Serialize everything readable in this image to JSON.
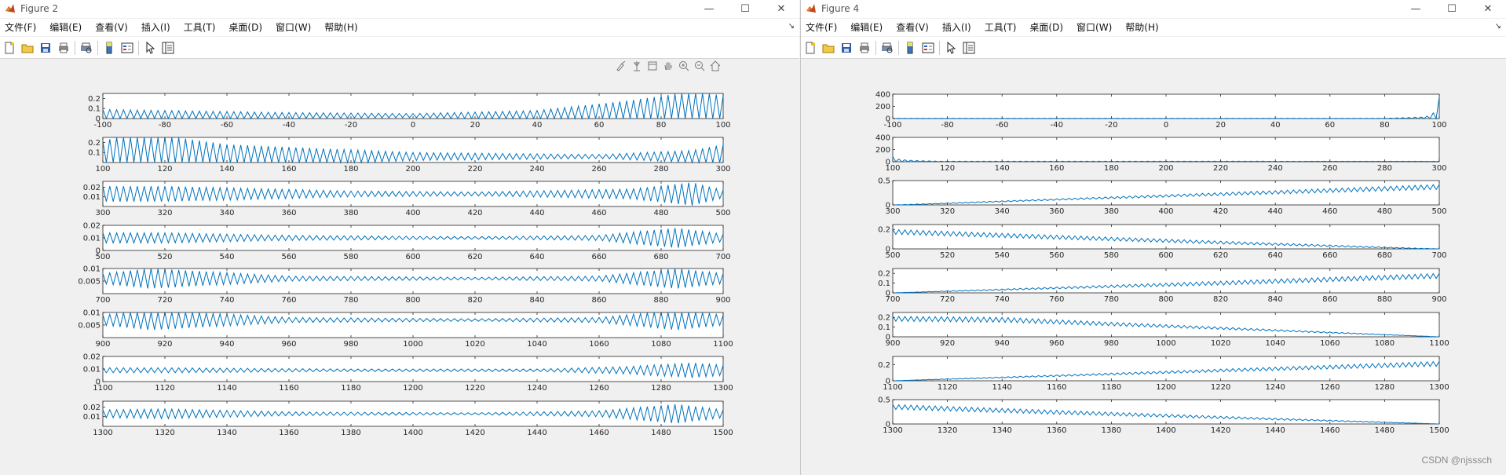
{
  "windows": [
    {
      "title": "Figure 2",
      "menu": [
        "文件(F)",
        "编辑(E)",
        "查看(V)",
        "插入(I)",
        "工具(T)",
        "桌面(D)",
        "窗口(W)",
        "帮助(H)"
      ],
      "toolbar_icons": [
        "new-figure-icon",
        "open-file-icon",
        "save-icon",
        "print-icon",
        "separator",
        "print-preview-icon",
        "separator",
        "colorbar-icon",
        "legend-icon",
        "separator",
        "pointer-icon",
        "property-inspector-icon"
      ],
      "axes_toolbar": [
        "brush-icon",
        "data-cursor-icon",
        "rotate-icon",
        "pan-icon",
        "zoom-in-icon",
        "zoom-out-icon",
        "home-icon"
      ]
    },
    {
      "title": "Figure 4",
      "menu": [
        "文件(F)",
        "编辑(E)",
        "查看(V)",
        "插入(I)",
        "工具(T)",
        "桌面(D)",
        "窗口(W)",
        "帮助(H)"
      ],
      "toolbar_icons": [
        "new-figure-icon",
        "open-file-icon",
        "save-icon",
        "print-icon",
        "separator",
        "print-preview-icon",
        "separator",
        "colorbar-icon",
        "legend-icon",
        "separator",
        "pointer-icon",
        "property-inspector-icon"
      ]
    }
  ],
  "watermark": "CSDN @njsssch",
  "colors": {
    "line": "#0072bd",
    "axes_bg": "#ffffff",
    "figure_bg": "#f0f0f0"
  },
  "chart_data": [
    {
      "figure": "Figure 2",
      "type": "line",
      "subplots": [
        {
          "xlim": [
            -100,
            100
          ],
          "xticks": [
            -100,
            -80,
            -60,
            -40,
            -20,
            0,
            20,
            40,
            60,
            80,
            100
          ],
          "yticks": [
            0,
            0.1,
            0.2
          ],
          "ytick_labels": [
            "0",
            "0.1",
            "0.2"
          ],
          "ylim": [
            0,
            0.25
          ],
          "envelope": [
            [
              -100,
              0.06
            ],
            [
              -80,
              0.05
            ],
            [
              -40,
              0.03
            ],
            [
              0,
              0.02
            ],
            [
              40,
              0.05
            ],
            [
              70,
              0.15
            ],
            [
              90,
              0.24
            ],
            [
              100,
              0.2
            ]
          ],
          "baseline": 0.03
        },
        {
          "xlim": [
            100,
            300
          ],
          "xticks": [
            100,
            120,
            140,
            160,
            180,
            200,
            220,
            240,
            260,
            280,
            300
          ],
          "yticks": [
            0.1,
            0.2
          ],
          "ytick_labels": [
            "0.1",
            "0.2"
          ],
          "ylim": [
            0,
            0.25
          ],
          "envelope": [
            [
              100,
              0.15
            ],
            [
              110,
              0.25
            ],
            [
              140,
              0.12
            ],
            [
              200,
              0.04
            ],
            [
              260,
              0.02
            ],
            [
              290,
              0.06
            ],
            [
              300,
              0.12
            ]
          ],
          "baseline": 0.06
        },
        {
          "xlim": [
            300,
            500
          ],
          "xticks": [
            300,
            320,
            340,
            360,
            380,
            400,
            420,
            440,
            460,
            480,
            500
          ],
          "yticks": [
            0.01,
            0.02
          ],
          "ytick_labels": [
            "0.01",
            "0.02"
          ],
          "ylim": [
            0,
            0.026
          ],
          "envelope": [
            [
              300,
              0.008
            ],
            [
              320,
              0.008
            ],
            [
              380,
              0.003
            ],
            [
              420,
              0.002
            ],
            [
              470,
              0.005
            ],
            [
              490,
              0.012
            ],
            [
              500,
              0.004
            ]
          ],
          "baseline": 0.013
        },
        {
          "xlim": [
            500,
            700
          ],
          "xticks": [
            500,
            520,
            540,
            560,
            580,
            600,
            620,
            640,
            660,
            680,
            700
          ],
          "yticks": [
            0,
            0.01,
            0.02
          ],
          "ytick_labels": [
            "0",
            "0.01",
            "0.02"
          ],
          "ylim": [
            0,
            0.02
          ],
          "envelope": [
            [
              500,
              0.004
            ],
            [
              520,
              0.004
            ],
            [
              560,
              0.002
            ],
            [
              620,
              0.001
            ],
            [
              660,
              0.002
            ],
            [
              685,
              0.008
            ],
            [
              700,
              0.003
            ]
          ],
          "baseline": 0.01
        },
        {
          "xlim": [
            700,
            900
          ],
          "xticks": [
            700,
            720,
            740,
            760,
            780,
            800,
            820,
            840,
            860,
            880,
            900
          ],
          "yticks": [
            0.005,
            0.01
          ],
          "ytick_labels": [
            "0.005",
            "0.01"
          ],
          "ylim": [
            0,
            0.01
          ],
          "envelope": [
            [
              700,
              0.002
            ],
            [
              715,
              0.004
            ],
            [
              760,
              0.001
            ],
            [
              820,
              0.0005
            ],
            [
              860,
              0.001
            ],
            [
              885,
              0.004
            ],
            [
              900,
              0.002
            ]
          ],
          "baseline": 0.006
        },
        {
          "xlim": [
            900,
            1100
          ],
          "xticks": [
            900,
            920,
            940,
            960,
            980,
            1000,
            1020,
            1040,
            1060,
            1080,
            1100
          ],
          "yticks": [
            0.005,
            0.01
          ],
          "ytick_labels": [
            "0.005",
            "0.01"
          ],
          "ylim": [
            0,
            0.01
          ],
          "envelope": [
            [
              900,
              0.002
            ],
            [
              915,
              0.004
            ],
            [
              960,
              0.001
            ],
            [
              1020,
              0.0005
            ],
            [
              1060,
              0.001
            ],
            [
              1085,
              0.004
            ],
            [
              1100,
              0.002
            ]
          ],
          "baseline": 0.007
        },
        {
          "xlim": [
            1100,
            1300
          ],
          "xticks": [
            1100,
            1120,
            1140,
            1160,
            1180,
            1200,
            1220,
            1240,
            1260,
            1280,
            1300
          ],
          "yticks": [
            0,
            0.01,
            0.02
          ],
          "ytick_labels": [
            "0",
            "0.01",
            "0.02"
          ],
          "ylim": [
            0,
            0.02
          ],
          "envelope": [
            [
              1100,
              0.002
            ],
            [
              1120,
              0.002
            ],
            [
              1180,
              0.001
            ],
            [
              1240,
              0.001
            ],
            [
              1270,
              0.003
            ],
            [
              1290,
              0.006
            ],
            [
              1300,
              0.004
            ]
          ],
          "baseline": 0.009
        },
        {
          "xlim": [
            1300,
            1500
          ],
          "xticks": [
            1300,
            1320,
            1340,
            1360,
            1380,
            1400,
            1420,
            1440,
            1460,
            1480,
            1500
          ],
          "yticks": [
            0.01,
            0.02
          ],
          "ytick_labels": [
            "0.01",
            "0.02"
          ],
          "ylim": [
            0,
            0.026
          ],
          "envelope": [
            [
              1300,
              0.004
            ],
            [
              1320,
              0.005
            ],
            [
              1360,
              0.002
            ],
            [
              1420,
              0.001
            ],
            [
              1460,
              0.003
            ],
            [
              1485,
              0.01
            ],
            [
              1500,
              0.004
            ]
          ],
          "baseline": 0.013
        }
      ]
    },
    {
      "figure": "Figure 4",
      "type": "line",
      "subplots": [
        {
          "xlim": [
            -100,
            100
          ],
          "xticks": [
            -100,
            -80,
            -60,
            -40,
            -20,
            0,
            20,
            40,
            60,
            80,
            100
          ],
          "yticks": [
            0,
            200,
            400
          ],
          "ytick_labels": [
            "0",
            "200",
            "400"
          ],
          "ylim": [
            0,
            400
          ],
          "envelope": [
            [
              -100,
              3
            ],
            [
              80,
              3
            ],
            [
              95,
              25
            ],
            [
              99,
              120
            ],
            [
              100,
              350
            ]
          ],
          "baseline": 2
        },
        {
          "xlim": [
            100,
            300
          ],
          "xticks": [
            100,
            120,
            140,
            160,
            180,
            200,
            220,
            240,
            260,
            280,
            300
          ],
          "yticks": [
            0,
            200,
            400
          ],
          "ytick_labels": [
            "0",
            "200",
            "400"
          ],
          "ylim": [
            0,
            400
          ],
          "envelope": [
            [
              100,
              80
            ],
            [
              102,
              40
            ],
            [
              106,
              20
            ],
            [
              115,
              6
            ],
            [
              300,
              2
            ]
          ],
          "baseline": 5
        },
        {
          "xlim": [
            300,
            500
          ],
          "xticks": [
            300,
            320,
            340,
            360,
            380,
            400,
            420,
            440,
            460,
            480,
            500
          ],
          "yticks": [
            0,
            0.5
          ],
          "ytick_labels": [
            "0",
            "0.5"
          ],
          "ylim": [
            0,
            0.5
          ],
          "envelope": [
            [
              300,
              0.01
            ],
            [
              360,
              0.03
            ],
            [
              420,
              0.06
            ],
            [
              460,
              0.08
            ],
            [
              500,
              0.1
            ]
          ],
          "trend": [
            [
              300,
              0.0
            ],
            [
              500,
              0.42
            ]
          ]
        },
        {
          "xlim": [
            500,
            700
          ],
          "xticks": [
            500,
            520,
            540,
            560,
            580,
            600,
            620,
            640,
            660,
            680,
            700
          ],
          "yticks": [
            0,
            0.2
          ],
          "ytick_labels": [
            "0",
            "0.2"
          ],
          "ylim": [
            0,
            0.25
          ],
          "envelope": [
            [
              500,
              0.05
            ],
            [
              560,
              0.04
            ],
            [
              620,
              0.03
            ],
            [
              700,
              0.005
            ]
          ],
          "trend": [
            [
              500,
              0.2
            ],
            [
              700,
              0.0
            ]
          ]
        },
        {
          "xlim": [
            700,
            900
          ],
          "xticks": [
            700,
            720,
            740,
            760,
            780,
            800,
            820,
            840,
            860,
            880,
            900
          ],
          "yticks": [
            0,
            0.1,
            0.2
          ],
          "ytick_labels": [
            "0",
            "0.1",
            "0.2"
          ],
          "ylim": [
            0,
            0.25
          ],
          "envelope": [
            [
              700,
              0.0
            ],
            [
              760,
              0.02
            ],
            [
              820,
              0.04
            ],
            [
              900,
              0.05
            ]
          ],
          "trend": [
            [
              700,
              0.0
            ],
            [
              900,
              0.2
            ]
          ]
        },
        {
          "xlim": [
            900,
            1100
          ],
          "xticks": [
            900,
            920,
            940,
            960,
            980,
            1000,
            1020,
            1040,
            1060,
            1080,
            1100
          ],
          "yticks": [
            0,
            0.1,
            0.2
          ],
          "ytick_labels": [
            "0",
            "0.1",
            "0.2"
          ],
          "ylim": [
            0,
            0.25
          ],
          "envelope": [
            [
              900,
              0.05
            ],
            [
              940,
              0.05
            ],
            [
              1000,
              0.03
            ],
            [
              1100,
              0.0
            ]
          ],
          "trend": [
            [
              900,
              0.21
            ],
            [
              940,
              0.2
            ],
            [
              1100,
              0.0
            ]
          ]
        },
        {
          "xlim": [
            1100,
            1300
          ],
          "xticks": [
            1100,
            1120,
            1140,
            1160,
            1180,
            1200,
            1220,
            1240,
            1260,
            1280,
            1300
          ],
          "yticks": [
            0,
            0.2
          ],
          "ytick_labels": [
            "0",
            "0.2"
          ],
          "ylim": [
            0,
            0.3
          ],
          "envelope": [
            [
              1100,
              0.0
            ],
            [
              1160,
              0.02
            ],
            [
              1240,
              0.04
            ],
            [
              1300,
              0.06
            ]
          ],
          "trend": [
            [
              1100,
              0.0
            ],
            [
              1300,
              0.24
            ]
          ]
        },
        {
          "xlim": [
            1300,
            1500
          ],
          "xticks": [
            1300,
            1320,
            1340,
            1360,
            1380,
            1400,
            1420,
            1440,
            1460,
            1480,
            1500
          ],
          "yticks": [
            0,
            0.5
          ],
          "ytick_labels": [
            "0",
            "0.5"
          ],
          "ylim": [
            0,
            0.5
          ],
          "envelope": [
            [
              1300,
              0.1
            ],
            [
              1360,
              0.08
            ],
            [
              1420,
              0.05
            ],
            [
              1500,
              0.0
            ]
          ],
          "trend": [
            [
              1300,
              0.4
            ],
            [
              1500,
              0.0
            ]
          ]
        }
      ]
    }
  ]
}
